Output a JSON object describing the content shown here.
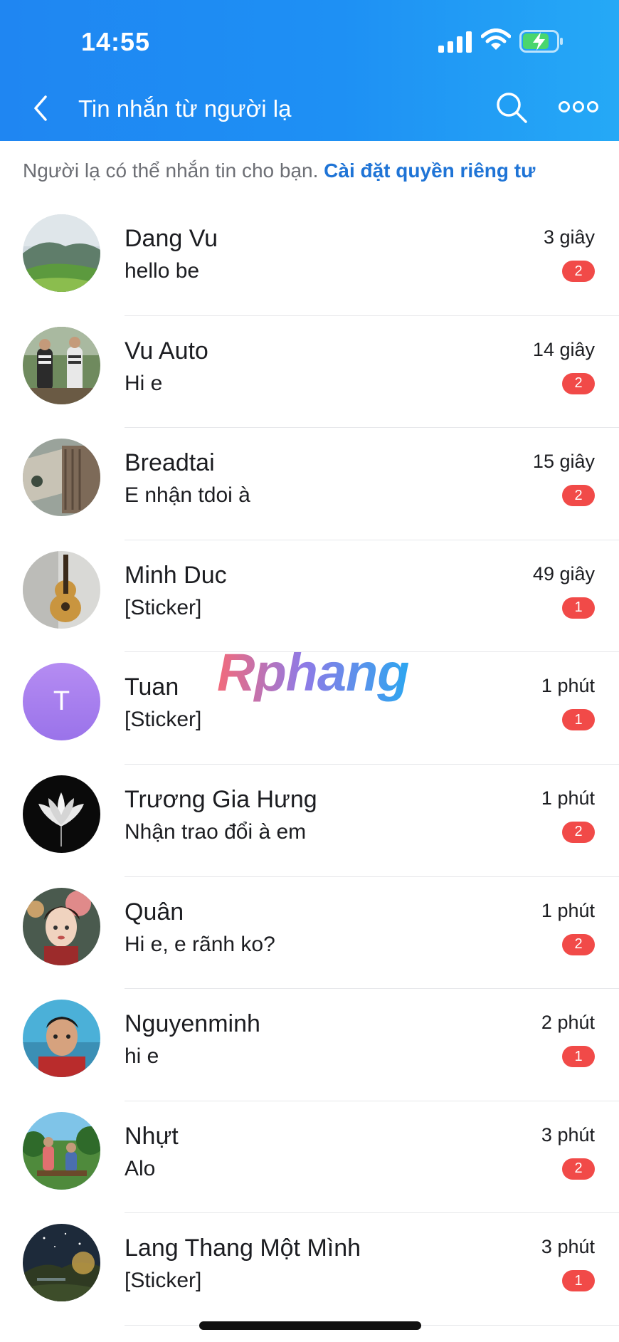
{
  "status_bar": {
    "time": "14:55"
  },
  "header": {
    "title": "Tin nhắn từ người lạ"
  },
  "notice": {
    "text": "Người lạ có thể nhắn tin cho bạn.",
    "link": "Cài đặt quyền riêng tư"
  },
  "watermark": "Rphang",
  "conversations": [
    {
      "name": "Dang Vu",
      "preview": "hello be",
      "time": "3 giây",
      "unread": "2",
      "avatar": "landscape"
    },
    {
      "name": "Vu Auto",
      "preview": "Hi e",
      "time": "14 giây",
      "unread": "2",
      "avatar": "people-outdoor"
    },
    {
      "name": "Breadtai",
      "preview": "E nhận tdoi à",
      "time": "15 giây",
      "unread": "2",
      "avatar": "money"
    },
    {
      "name": "Minh Duc",
      "preview": "[Sticker]",
      "time": "49 giây",
      "unread": "1",
      "avatar": "guitar"
    },
    {
      "name": "Tuan",
      "preview": "[Sticker]",
      "time": "1 phút",
      "unread": "1",
      "avatar_letter": "T"
    },
    {
      "name": "Trương Gia Hưng",
      "preview": "Nhận trao đổi à em",
      "time": "1 phút",
      "unread": "2",
      "avatar": "lotus"
    },
    {
      "name": "Quân",
      "preview": "Hi e, e rãnh ko?",
      "time": "1 phút",
      "unread": "2",
      "avatar": "girl-art"
    },
    {
      "name": "Nguyenminh",
      "preview": "hi e",
      "time": "2 phút",
      "unread": "1",
      "avatar": "man-portrait"
    },
    {
      "name": "Nhựt",
      "preview": "Alo",
      "time": "3 phút",
      "unread": "2",
      "avatar": "family-outdoor"
    },
    {
      "name": "Lang Thang Một Mình",
      "preview": "[Sticker]",
      "time": "3 phút",
      "unread": "1",
      "avatar": "night-sky"
    }
  ],
  "colors": {
    "header": "#1e90f4",
    "badge": "#f14a48",
    "link": "#1f74d6"
  }
}
